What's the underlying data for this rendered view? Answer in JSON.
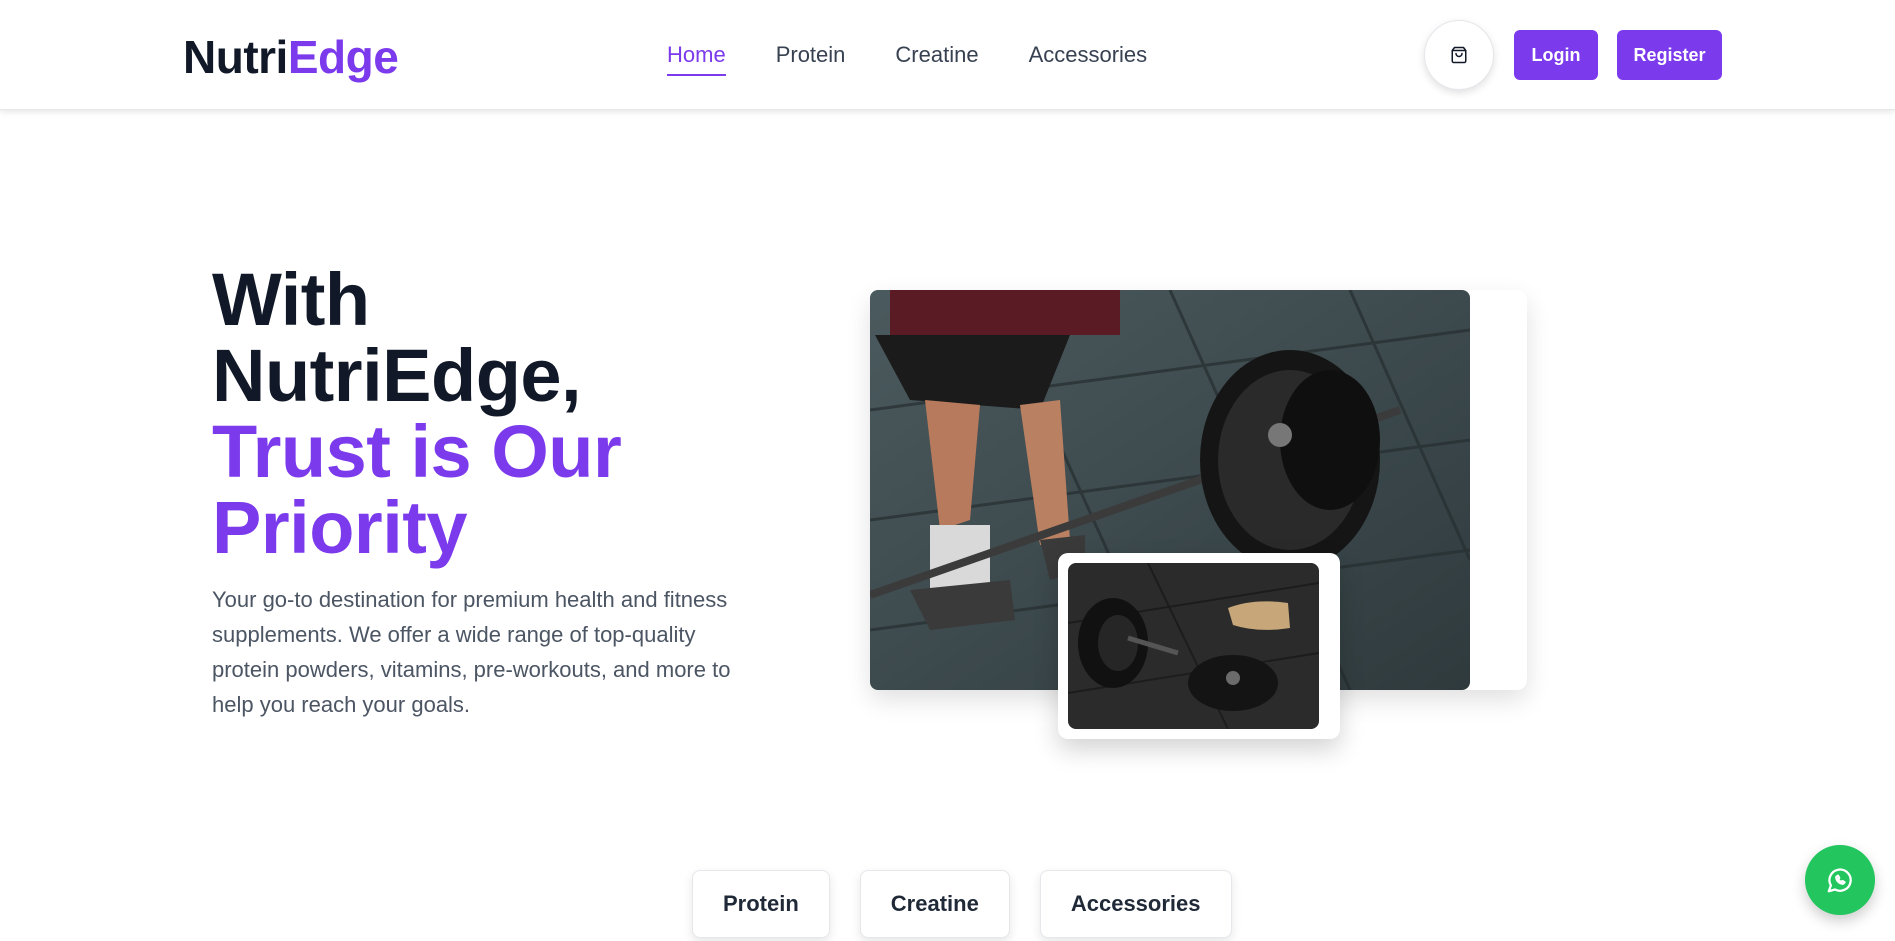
{
  "brand": {
    "part1": "Nutri",
    "part2": "Edge"
  },
  "nav": {
    "items": [
      {
        "label": "Home",
        "active": true
      },
      {
        "label": "Protein",
        "active": false
      },
      {
        "label": "Creatine",
        "active": false
      },
      {
        "label": "Accessories",
        "active": false
      }
    ]
  },
  "header": {
    "cart_icon": "shopping-bag-icon",
    "login_label": "Login",
    "register_label": "Register"
  },
  "hero": {
    "line1": "With",
    "line2": "NutriEdge,",
    "line3": "Trust is Our",
    "line4": "Priority",
    "description": "Your go-to destination for premium health and fitness supplements. We offer a wide range of top-quality protein powders, vitamins, pre-workouts, and more to help you reach your goals."
  },
  "categories": {
    "items": [
      "Protein",
      "Creatine",
      "Accessories"
    ]
  },
  "whatsapp": {
    "icon": "whatsapp-icon"
  },
  "colors": {
    "accent": "#7c3aed",
    "whatsapp": "#22c55e"
  }
}
